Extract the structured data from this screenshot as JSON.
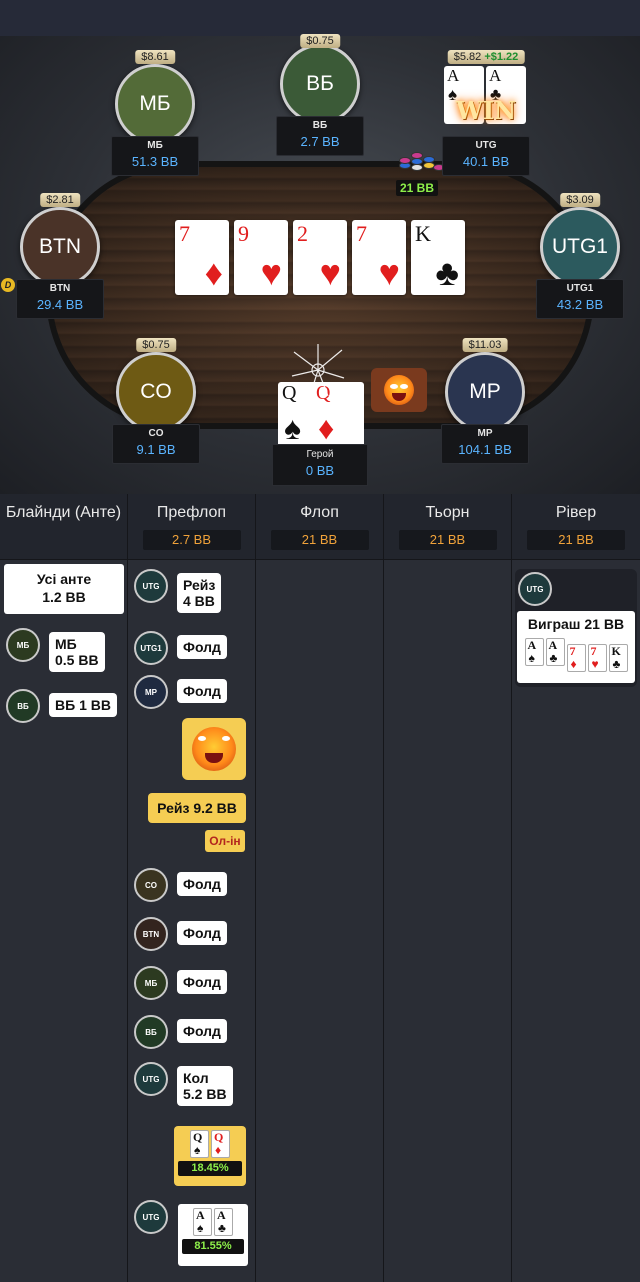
{
  "colors": {
    "accent_blue": "#5ab4ff",
    "pot_green": "#8ef04a",
    "pot_orange": "#f0a23a",
    "highlight_yellow": "#f5cd53"
  },
  "table": {
    "seats": {
      "sb": {
        "label": "МБ",
        "bet": "$8.61",
        "name": "МБ",
        "stack": "51.3 BB",
        "color": "#536b38"
      },
      "bb": {
        "label": "ВБ",
        "bet": "$0.75",
        "name": "ВБ",
        "stack": "2.7 BB",
        "color": "#3b5a37"
      },
      "utg": {
        "bet": "$5.82",
        "gain": "+$1.22",
        "name": "UTG",
        "stack": "40.1 BB",
        "win_text": "WIN",
        "cards": [
          {
            "rank": "A",
            "suit": "♠"
          },
          {
            "rank": "A",
            "suit": "♣"
          }
        ]
      },
      "btn": {
        "label": "BTN",
        "bet": "$2.81",
        "name": "BTN",
        "stack": "29.4 BB",
        "color": "#4a3328"
      },
      "utg1": {
        "label": "UTG1",
        "bet": "$3.09",
        "name": "UTG1",
        "stack": "43.2 BB",
        "color": "#2c5a5e"
      },
      "co": {
        "label": "CO",
        "bet": "$0.75",
        "name": "CO",
        "stack": "9.1 BB",
        "color": "#6e5a14"
      },
      "mp": {
        "label": "MP",
        "bet": "$11.03",
        "name": "MP",
        "stack": "104.1 BB",
        "color": "#2a3550"
      }
    },
    "dealer_button": "D",
    "board": [
      {
        "rank": "7",
        "suit": "♦",
        "color": "red"
      },
      {
        "rank": "9",
        "suit": "♥",
        "color": "red"
      },
      {
        "rank": "2",
        "suit": "♥",
        "color": "red"
      },
      {
        "rank": "7",
        "suit": "♥",
        "color": "red"
      },
      {
        "rank": "K",
        "suit": "♣",
        "color": "black"
      }
    ],
    "pot": "21 BB",
    "hero": {
      "name": "Герой",
      "stack": "0 BB",
      "cards": [
        {
          "rank": "Q",
          "suit": "♠",
          "color": "black"
        },
        {
          "rank": "Q",
          "suit": "♦",
          "color": "red"
        }
      ]
    },
    "emoji_icon": "angry-fire-emoji"
  },
  "history": {
    "columns": [
      {
        "title": "Блайнди (Анте)",
        "pot": ""
      },
      {
        "title": "Префлоп",
        "pot": "2.7 BB"
      },
      {
        "title": "Флоп",
        "pot": "21 BB"
      },
      {
        "title": "Тьорн",
        "pot": "21 BB"
      },
      {
        "title": "Рівер",
        "pot": "21 BB"
      }
    ],
    "blinds": {
      "ante_line1": "Усі анте",
      "ante_line2": "1.2 BB",
      "sb_badge": "МБ",
      "sb_line1": "МБ",
      "sb_line2": "0.5 BB",
      "bb_badge": "ВБ",
      "bb_text": "ВБ 1 BB"
    },
    "preflop": {
      "a1": {
        "badge": "UTG",
        "line1": "Рейз",
        "line2": "4 BB"
      },
      "a2": {
        "badge": "UTG1",
        "text": "Фолд"
      },
      "a3": {
        "badge": "MP",
        "text": "Фолд"
      },
      "hero_raise": "Рейз 9.2 BB",
      "hero_allin": "Ол-ін",
      "a5": {
        "badge": "CO",
        "text": "Фолд"
      },
      "a6": {
        "badge": "BTN",
        "text": "Фолд"
      },
      "a7": {
        "badge": "МБ",
        "text": "Фолд"
      },
      "a8": {
        "badge": "ВБ",
        "text": "Фолд"
      },
      "a9": {
        "badge": "UTG",
        "line1": "Кол",
        "line2": "5.2 BB"
      },
      "hero_equity": "18.45%",
      "hero_cards": [
        {
          "rank": "Q",
          "suit": "♠",
          "color": "black"
        },
        {
          "rank": "Q",
          "suit": "♦",
          "color": "red"
        }
      ],
      "utg_badge": "UTG",
      "utg_equity": "81.55%",
      "utg_cards": [
        {
          "rank": "A",
          "suit": "♠",
          "color": "black"
        },
        {
          "rank": "A",
          "suit": "♣",
          "color": "black"
        }
      ]
    },
    "river": {
      "badge": "UTG",
      "win_text": "Виграш 21 BB",
      "cards": [
        {
          "rank": "A",
          "suit": "♠",
          "color": "black"
        },
        {
          "rank": "A",
          "suit": "♣",
          "color": "black"
        },
        {
          "rank": "7",
          "suit": "♦",
          "color": "red"
        },
        {
          "rank": "7",
          "suit": "♥",
          "color": "red"
        },
        {
          "rank": "K",
          "suit": "♣",
          "color": "black"
        }
      ]
    }
  }
}
